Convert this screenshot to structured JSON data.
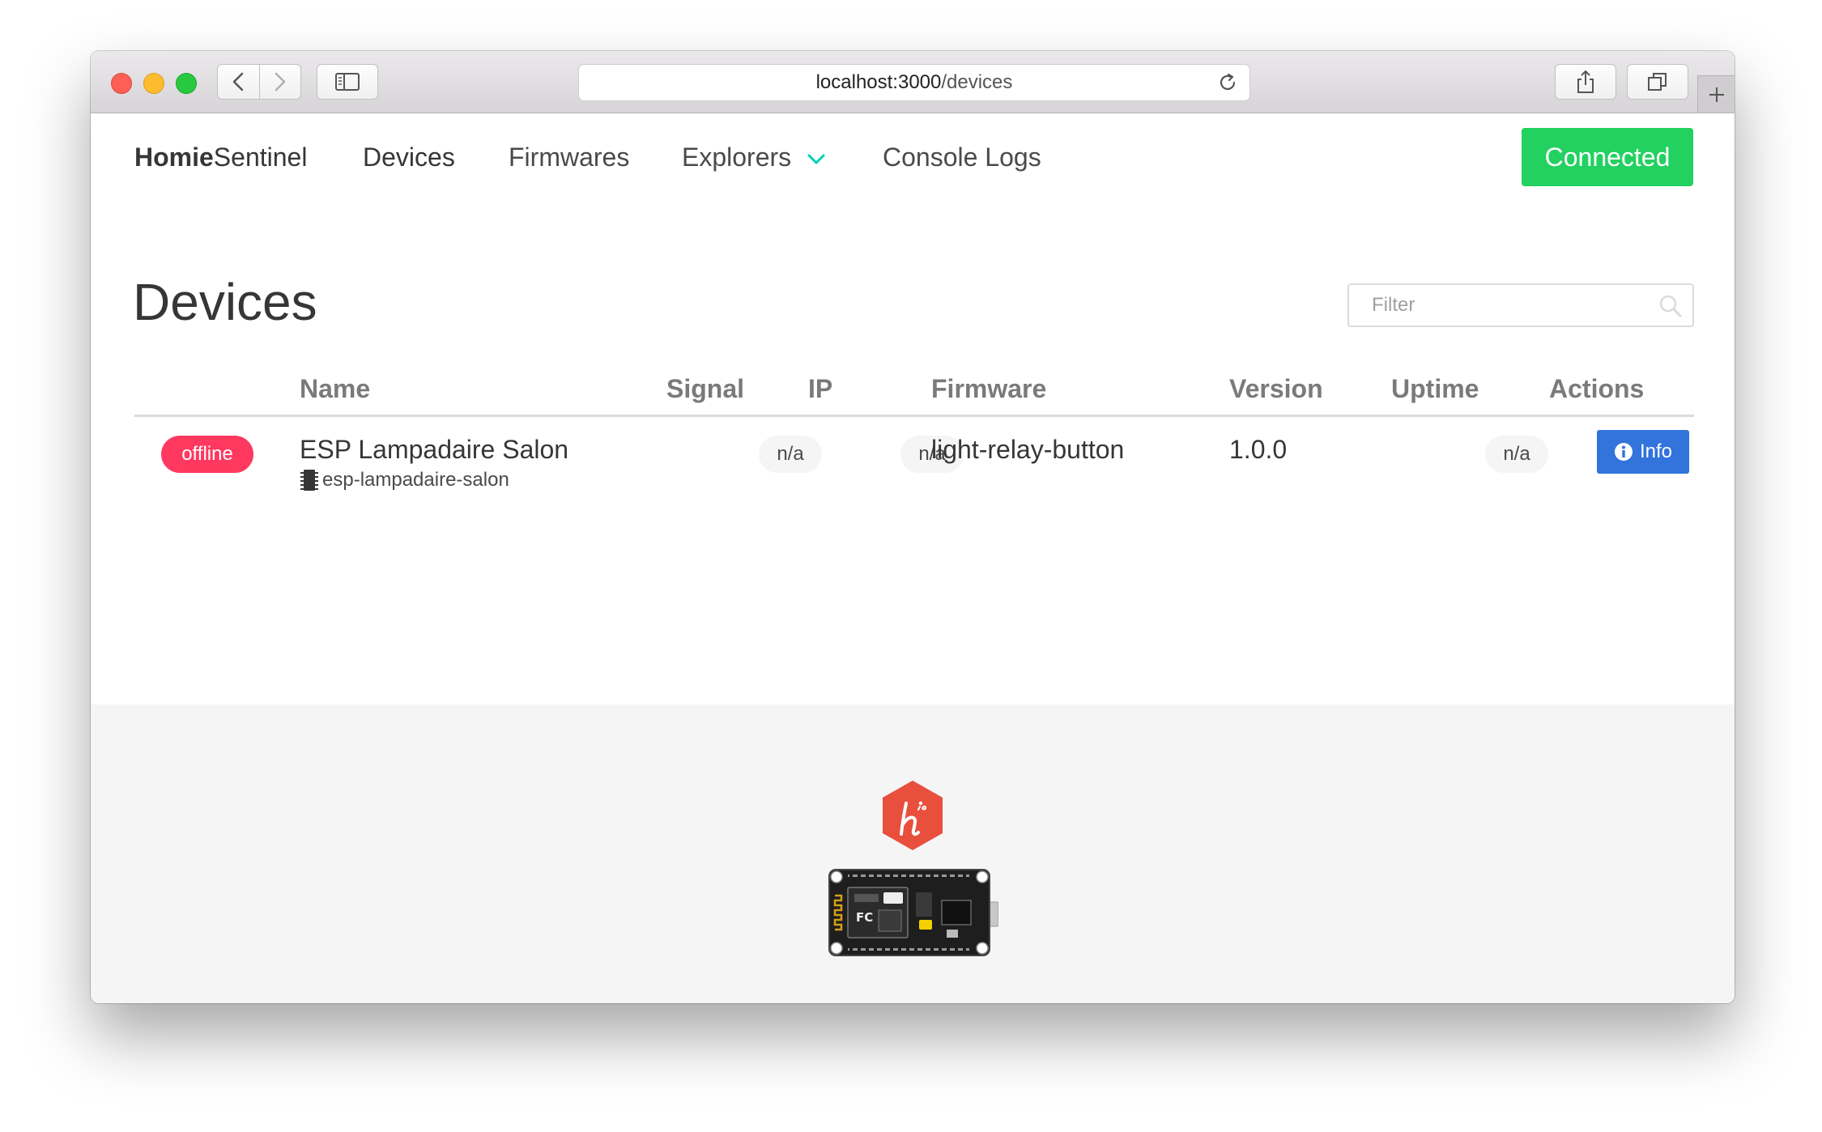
{
  "browser": {
    "url_host": "localhost:3000",
    "url_path": "/devices"
  },
  "navbar": {
    "brand_bold": "Homie",
    "brand_rest": "Sentinel",
    "items": [
      {
        "label": "Devices",
        "active": true
      },
      {
        "label": "Firmwares",
        "active": false
      },
      {
        "label": "Explorers",
        "active": false,
        "has_dropdown": true
      },
      {
        "label": "Console Logs",
        "active": false
      }
    ],
    "status_label": "Connected",
    "status_color": "#23d160"
  },
  "main": {
    "title": "Devices",
    "filter_placeholder": "Filter"
  },
  "table": {
    "columns": [
      "",
      "Name",
      "Signal",
      "IP",
      "Firmware",
      "Version",
      "Uptime",
      "Actions"
    ],
    "rows": [
      {
        "status": "offline",
        "status_color": "#ff3860",
        "name": "ESP Lampadaire Salon",
        "device_id": "esp-lampadaire-salon",
        "signal": "n/a",
        "ip": "n/a",
        "firmware": "light-relay-button",
        "version": "1.0.0",
        "uptime": "n/a",
        "action_label": "Info"
      }
    ]
  },
  "footer": {
    "logo_icon": "homie-logo-icon",
    "board_icon": "esp8266-board-icon"
  }
}
